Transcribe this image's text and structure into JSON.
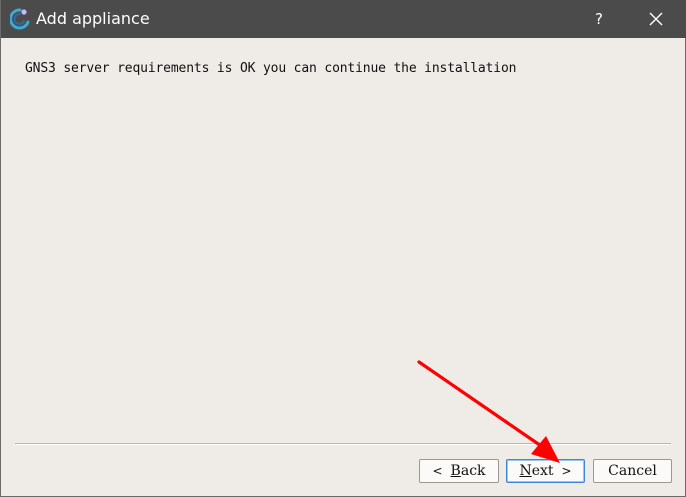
{
  "window": {
    "title": "Add appliance",
    "help_label": "?"
  },
  "main": {
    "message": "GNS3 server requirements is OK you can continue the installation"
  },
  "buttons": {
    "back": {
      "arrow": "<",
      "label_mnemonic": "B",
      "label_rest": "ack"
    },
    "next": {
      "label_mnemonic": "N",
      "label_rest": "ext",
      "arrow": ">"
    },
    "cancel": {
      "label": "Cancel"
    }
  },
  "icons": {
    "app": "gns3-logo-icon",
    "close": "close-icon",
    "annotation": "red-arrow-icon"
  },
  "colors": {
    "titlebar": "#4b4b4b",
    "window_bg": "#efebe7",
    "annotation_arrow": "#ff0000",
    "default_button_border": "#3c86d8"
  }
}
